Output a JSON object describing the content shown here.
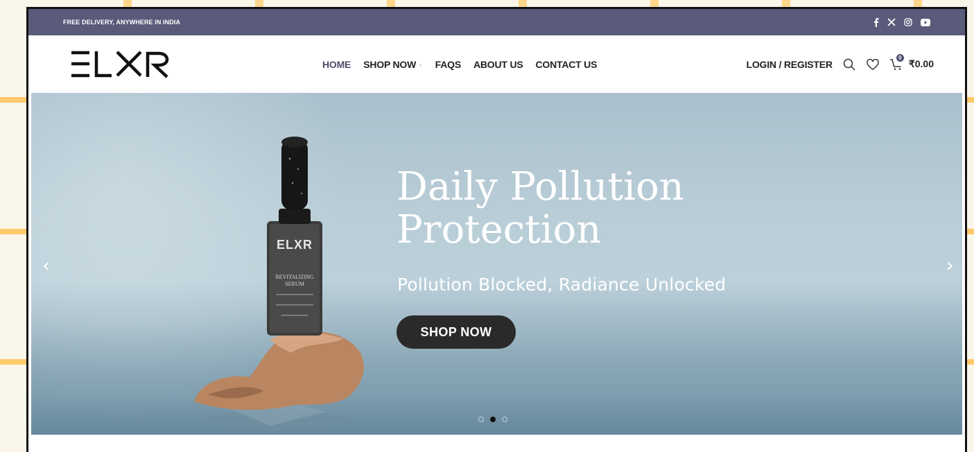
{
  "topbar": {
    "promo": "FREE DELIVERY, ANYWHERE IN INDIA",
    "social_icons": [
      "facebook-icon",
      "x-icon",
      "instagram-icon",
      "youtube-icon"
    ]
  },
  "header": {
    "logo_text": "ELXR",
    "nav": [
      {
        "label": "HOME",
        "active": true
      },
      {
        "label": "SHOP NOW",
        "has_dropdown": true
      },
      {
        "label": "FAQS"
      },
      {
        "label": "ABOUT US"
      },
      {
        "label": "CONTACT US"
      }
    ],
    "login_label": "LOGIN / REGISTER",
    "cart_count": "0",
    "cart_total": "₹0.00"
  },
  "hero": {
    "title_line1": "Daily Pollution",
    "title_line2": "Protection",
    "subtitle": "Pollution Blocked, Radiance Unlocked",
    "cta_label": "SHOP NOW",
    "prev_arrow": "‹",
    "next_arrow": "›",
    "slides": 3,
    "active_slide": 2,
    "product_label": {
      "brand": "ELXR",
      "line1": "REVITALIZING",
      "line2": "SERUM"
    }
  },
  "colors": {
    "topbar_bg": "#5a5a7a",
    "accent": "#4b4d6b",
    "button_bg": "#2a2a2a"
  }
}
